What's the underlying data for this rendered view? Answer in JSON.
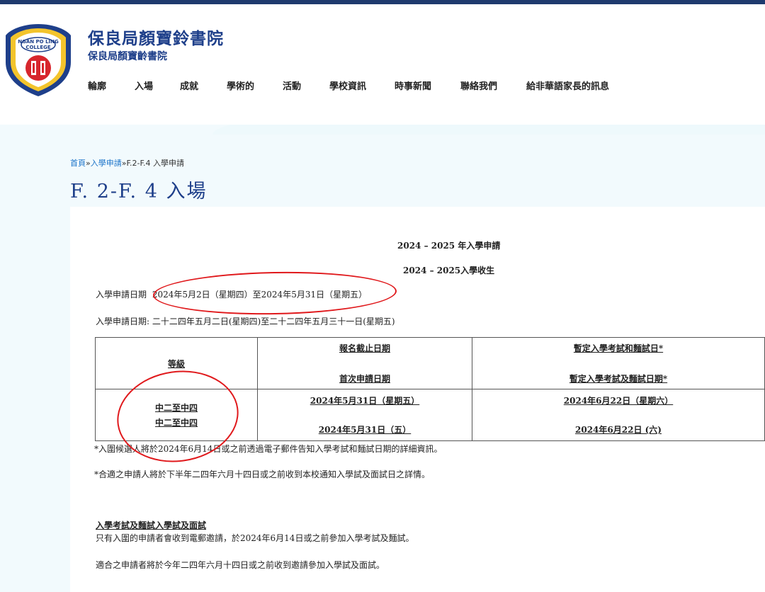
{
  "header": {
    "school_name": "保良局顏寶鈴書院",
    "school_subname": "保良局顏寶齡書院",
    "logo_text": "NGAN PO LING COLLEGE"
  },
  "nav": [
    {
      "label": "輪廓"
    },
    {
      "label": "入場"
    },
    {
      "label": "成就"
    },
    {
      "label": "學術的"
    },
    {
      "label": "活動"
    },
    {
      "label": "學校資訊"
    },
    {
      "label": "時事新聞"
    },
    {
      "label": "聯絡我們"
    },
    {
      "label": "給非華語家長的訊息"
    }
  ],
  "breadcrumb": {
    "home": "首頁",
    "sep1": "»",
    "admission": "入學申請",
    "sep2": "»",
    "current": "F.2-F.4 入學申請"
  },
  "page_title": "F. 2-F. 4 入場",
  "content": {
    "heading1": "2024 – 2025 年入學申請",
    "heading2": "2024 – 2025入學收生",
    "date_label": "入學申請日期",
    "date_value": "2024年5月2日（星期四）至2024年5月31日（星期五）",
    "date_line2": "入學申請日期: 二十二四年五月二日(星期四)至二十二四年五月三十一日(星期五)",
    "table": {
      "col1_header": "等級",
      "col2_header_a": "報名截止日期",
      "col2_header_b": "首次申請日期",
      "col3_header_a": "暫定入學考試和麵試日*",
      "col3_header_b": "暫定入學考試及麵試日期*",
      "row_level_a": "中二至中四",
      "row_level_b": "中二至中四",
      "row_deadline_a": "2024年5月31日（星期五）",
      "row_deadline_b": "2024年5月31日（五）",
      "row_exam_a": "2024年6月22日（星期六）",
      "row_exam_b": "2024年6月22日 (六)"
    },
    "note1": "*入圍候選人將於2024年6月14日或之前透過電子郵件告知入學考試和麵試日期的詳細資訊。",
    "note2": "*合適之申請人將於下半年二四年六月十四日或之前收到本校通知入學試及面試日之詳情。",
    "section_heading": "入學考試及麵試入學試及面試",
    "section_p1": "只有入圍的申請者會收到電郵邀請，於2024年6月14日或之前參加入學考試及麵試。",
    "section_p2": "適合之申請者將於今年二四年六月十四日或之前收到邀請參加入學試及面試。"
  },
  "colors": {
    "brand_blue": "#1e3f8a",
    "top_bar": "#1f3a6e",
    "link_blue": "#1a73c9",
    "annotation_red": "#e0191c"
  }
}
